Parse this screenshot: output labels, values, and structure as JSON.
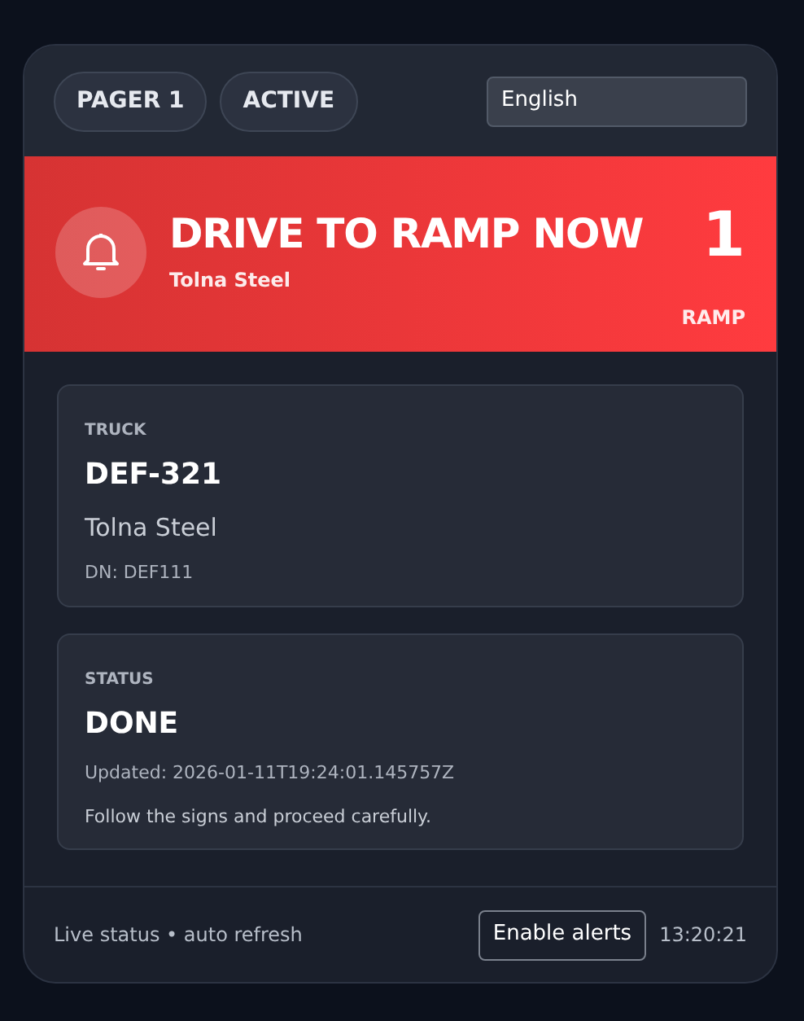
{
  "header": {
    "badges": [
      "PAGER 1",
      "ACTIVE"
    ],
    "language_select": {
      "value": "English"
    }
  },
  "alert": {
    "title": "DRIVE TO RAMP NOW",
    "subtitle": "Tolna Steel",
    "ramp_number": "1",
    "ramp_label": "RAMP"
  },
  "cards": [
    {
      "kind": "truck",
      "label": "TRUCK",
      "value": "DEF-321",
      "lines": [
        "Tolna Steel",
        "DN: DEF111"
      ]
    },
    {
      "kind": "status",
      "label": "STATUS",
      "value": "DONE",
      "lines": [
        "Updated: 2026-01-11T19:24:01.145757Z",
        "Follow the signs and proceed carefully."
      ]
    }
  ],
  "footer": {
    "status_text": "Live status • auto refresh",
    "button": "Enable alerts",
    "time": "13:20:21"
  }
}
